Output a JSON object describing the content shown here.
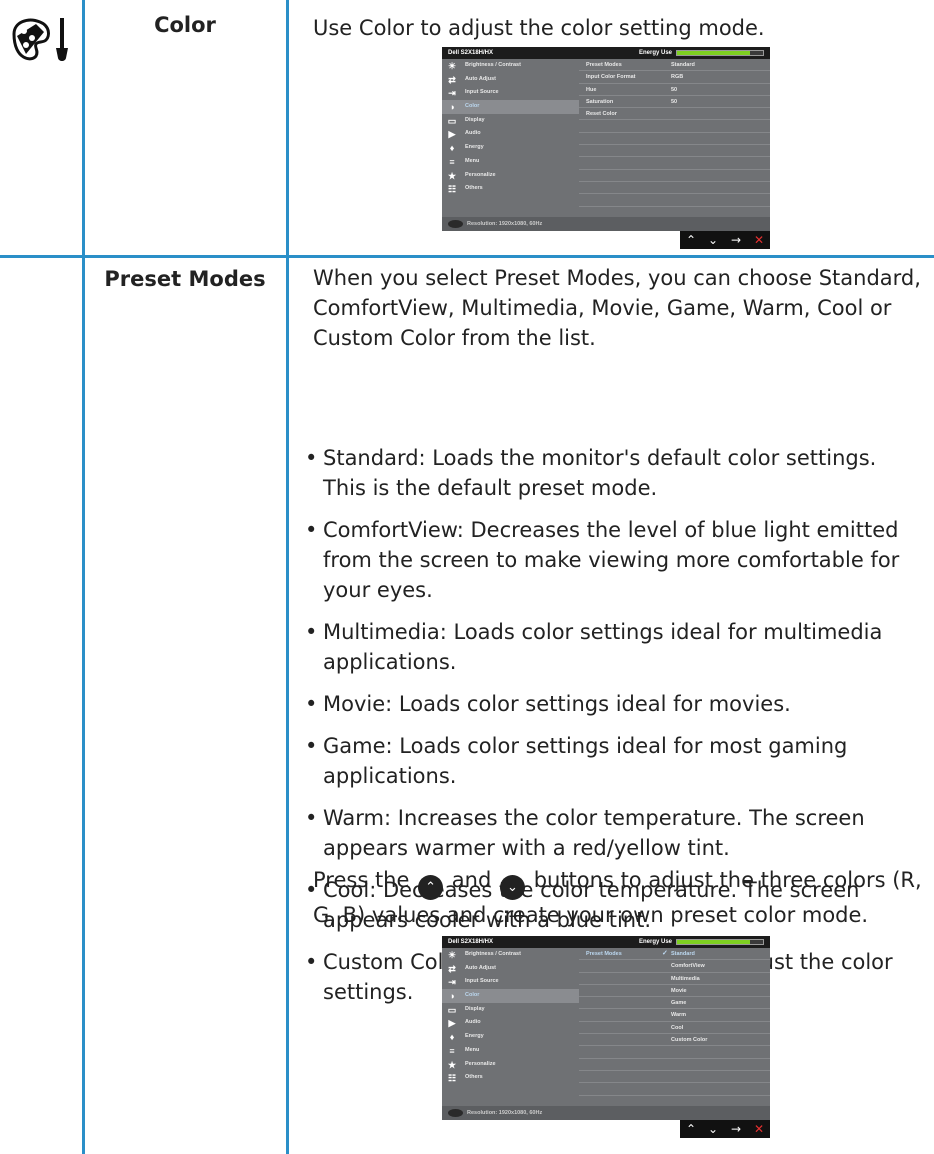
{
  "colors": {
    "rule": "#2a8fc8",
    "osd_bg": "#6f7174",
    "osd_header": "#1c1c1c",
    "energy": "#7ed021"
  },
  "rows": {
    "color": {
      "icon": "color-palette-icon",
      "label": "Color",
      "description": "Use Color to adjust the color setting mode."
    },
    "preset": {
      "label": "Preset Modes",
      "intro": "When you select Preset Modes, you can choose Standard, ComfortView, Multimedia, Movie, Game, Warm, Cool or Custom Color from the list.",
      "bullets": [
        "Standard: Loads the monitor's default color settings. This is the default preset mode.",
        "ComfortView: Decreases the level of blue light emitted from the screen to make viewing more comfortable for your eyes.",
        "Multimedia: Loads color settings ideal for multimedia applications.",
        "Movie: Loads color settings ideal for movies.",
        "Game: Loads color settings ideal for most gaming applications.",
        "Warm: Increases the color temperature. The screen appears warmer with a red/yellow tint.",
        "Cool: Decreases the color temperature. The screen appears cooler with a blue tint.",
        "Custom Color: Allows you to manually adjust the color settings."
      ],
      "press_pre": "Press the",
      "press_mid": "and",
      "press_post": "buttons to adjust the three colors (R, G, B) values and create your own preset color mode.",
      "up_icon": "up-arrow-icon",
      "down_icon": "down-arrow-icon"
    }
  },
  "osd": {
    "model": "Dell S2X18H/HX",
    "energy_label": "Energy Use",
    "energy_level": 0.85,
    "resolution": "Resolution: 1920x1080, 60Hz",
    "menu": [
      {
        "label": "Brightness / Contrast",
        "icon": "brightness-icon"
      },
      {
        "label": "Auto Adjust",
        "icon": "auto-adjust-icon"
      },
      {
        "label": "Input Source",
        "icon": "input-source-icon"
      },
      {
        "label": "Color",
        "icon": "color-icon"
      },
      {
        "label": "Display",
        "icon": "display-icon"
      },
      {
        "label": "Audio",
        "icon": "audio-icon"
      },
      {
        "label": "Energy",
        "icon": "energy-icon"
      },
      {
        "label": "Menu",
        "icon": "menu-icon"
      },
      {
        "label": "Personalize",
        "icon": "star-icon"
      },
      {
        "label": "Others",
        "icon": "others-icon"
      }
    ],
    "color_settings": [
      {
        "key": "Preset Modes",
        "value": "Standard"
      },
      {
        "key": "Input Color Format",
        "value": "RGB"
      },
      {
        "key": "Hue",
        "value": "50"
      },
      {
        "key": "Saturation",
        "value": "50"
      },
      {
        "key": "Reset Color",
        "value": ""
      }
    ],
    "preset_label": "Preset Modes",
    "preset_options": [
      "Standard",
      "ComfortView",
      "Multimedia",
      "Movie",
      "Game",
      "Warm",
      "Cool",
      "Custom Color"
    ],
    "preset_selected": "Standard",
    "nav": [
      "up-icon",
      "down-icon",
      "enter-icon",
      "exit-icon"
    ]
  }
}
